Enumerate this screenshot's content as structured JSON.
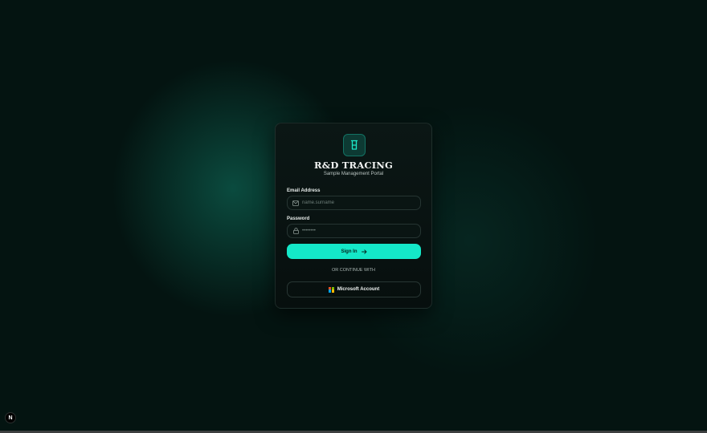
{
  "brand": {
    "title": "R&D TRACING",
    "subtitle": "Sample Management Portal",
    "logo_icon": "beaker-icon",
    "accent_color": "#14e8c8"
  },
  "form": {
    "email_label": "Email Address",
    "email_placeholder": "name.surname",
    "email_icon": "mail-icon",
    "password_label": "Password",
    "password_placeholder": "••••••••",
    "password_icon": "lock-icon",
    "signin_label": "Sign In",
    "signin_icon": "arrow-right-icon"
  },
  "alt_login": {
    "divider": "OR CONTINUE WITH",
    "microsoft_label": "Microsoft Account",
    "microsoft_icon": "microsoft-logo-icon",
    "microsoft_colors": [
      "#f25022",
      "#7fba00",
      "#00a4ef",
      "#ffb900"
    ]
  },
  "dev_badge": {
    "label": "N"
  }
}
